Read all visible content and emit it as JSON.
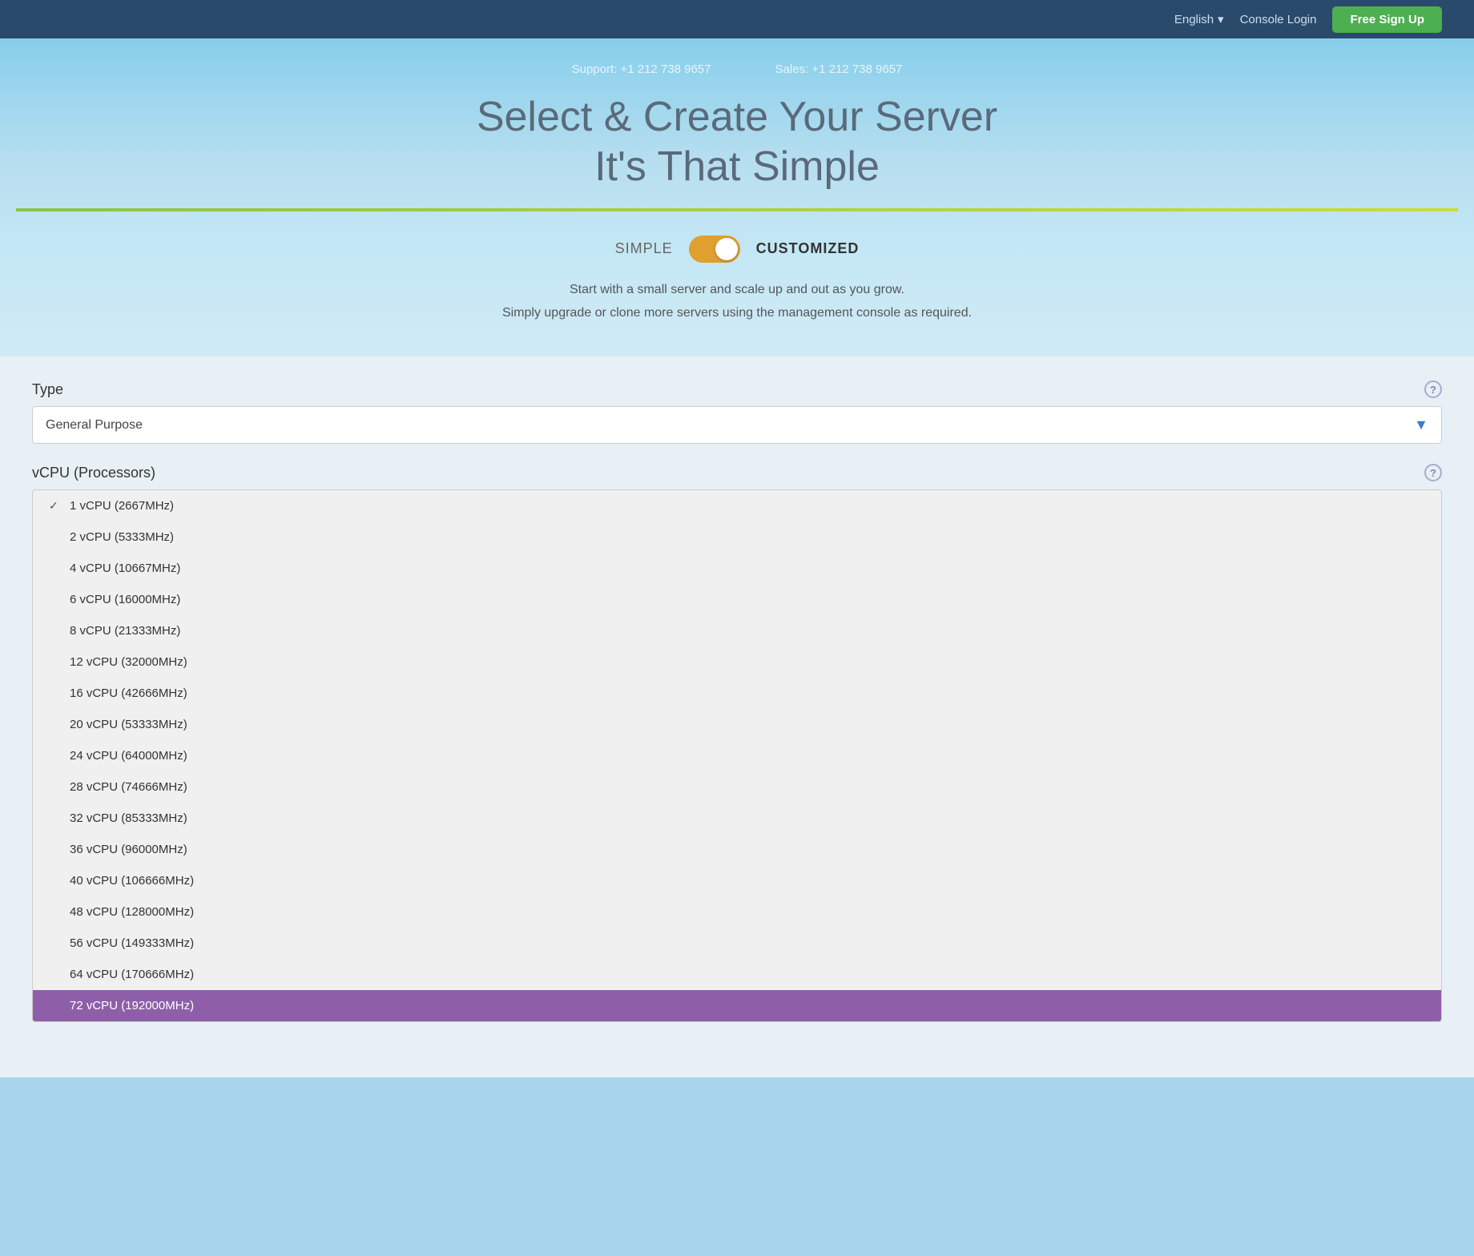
{
  "nav": {
    "language_label": "English",
    "console_login_label": "Console Login",
    "free_signup_label": "Free Sign Up"
  },
  "hero": {
    "support_text": "Support: +1 212 738 9657",
    "sales_text": "Sales: +1 212 738 9657",
    "title_line1": "Select & Create Your Server",
    "title_line2": "It's That Simple",
    "toggle_simple": "SIMPLE",
    "toggle_customized": "CUSTOMIZED",
    "desc_line1": "Start with a small server and scale up and out as you grow.",
    "desc_line2": "Simply upgrade or clone more servers using the management console as required."
  },
  "form": {
    "type_label": "Type",
    "type_value": "General Purpose",
    "vcpu_label": "vCPU (Processors)",
    "vcpu_options": [
      {
        "label": "1 vCPU (2667MHz)",
        "checked": true,
        "selected": false
      },
      {
        "label": "2 vCPU (5333MHz)",
        "checked": false,
        "selected": false
      },
      {
        "label": "4 vCPU (10667MHz)",
        "checked": false,
        "selected": false
      },
      {
        "label": "6 vCPU (16000MHz)",
        "checked": false,
        "selected": false
      },
      {
        "label": "8 vCPU (21333MHz)",
        "checked": false,
        "selected": false
      },
      {
        "label": "12 vCPU (32000MHz)",
        "checked": false,
        "selected": false
      },
      {
        "label": "16 vCPU (42666MHz)",
        "checked": false,
        "selected": false
      },
      {
        "label": "20 vCPU (53333MHz)",
        "checked": false,
        "selected": false
      },
      {
        "label": "24 vCPU (64000MHz)",
        "checked": false,
        "selected": false
      },
      {
        "label": "28 vCPU (74666MHz)",
        "checked": false,
        "selected": false
      },
      {
        "label": "32 vCPU (85333MHz)",
        "checked": false,
        "selected": false
      },
      {
        "label": "36 vCPU (96000MHz)",
        "checked": false,
        "selected": false
      },
      {
        "label": "40 vCPU (106666MHz)",
        "checked": false,
        "selected": false
      },
      {
        "label": "48 vCPU (128000MHz)",
        "checked": false,
        "selected": false
      },
      {
        "label": "56 vCPU (149333MHz)",
        "checked": false,
        "selected": false
      },
      {
        "label": "64 vCPU (170666MHz)",
        "checked": false,
        "selected": false
      },
      {
        "label": "72 vCPU (192000MHz)",
        "checked": false,
        "selected": true
      }
    ]
  },
  "icons": {
    "dropdown_arrow": "▼",
    "help": "?",
    "chevron": "▾"
  }
}
